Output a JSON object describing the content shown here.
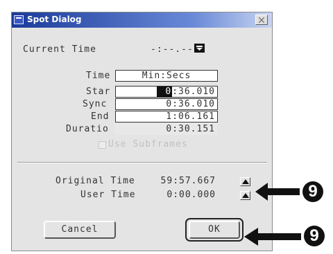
{
  "window": {
    "title": "Spot Dialog"
  },
  "current_time": {
    "label": "Current Time",
    "value": "-:--.---"
  },
  "time_format": {
    "label": "Time",
    "value": "Min:Secs"
  },
  "fields": [
    {
      "label": "Star",
      "value": ":36.010",
      "selected_part": "0"
    },
    {
      "label": "Sync",
      "value": "0:36.010"
    },
    {
      "label": "End",
      "value": "1:06.161"
    },
    {
      "label": "Duratio",
      "value": "0:30.151"
    }
  ],
  "use_subframes": {
    "label": "Use Subframes",
    "checked": false,
    "enabled": false
  },
  "original_time": {
    "label": "Original Time",
    "value": "59:57.667"
  },
  "user_time": {
    "label": "User Time",
    "value": "0:00.000"
  },
  "buttons": {
    "cancel": "Cancel",
    "ok": "OK"
  },
  "callouts": [
    "9",
    "9"
  ],
  "icons": {
    "close": "close-icon",
    "dropdown": "dropdown-icon",
    "step_up": "up-triangle-icon",
    "arrow": "left-arrow-icon"
  }
}
